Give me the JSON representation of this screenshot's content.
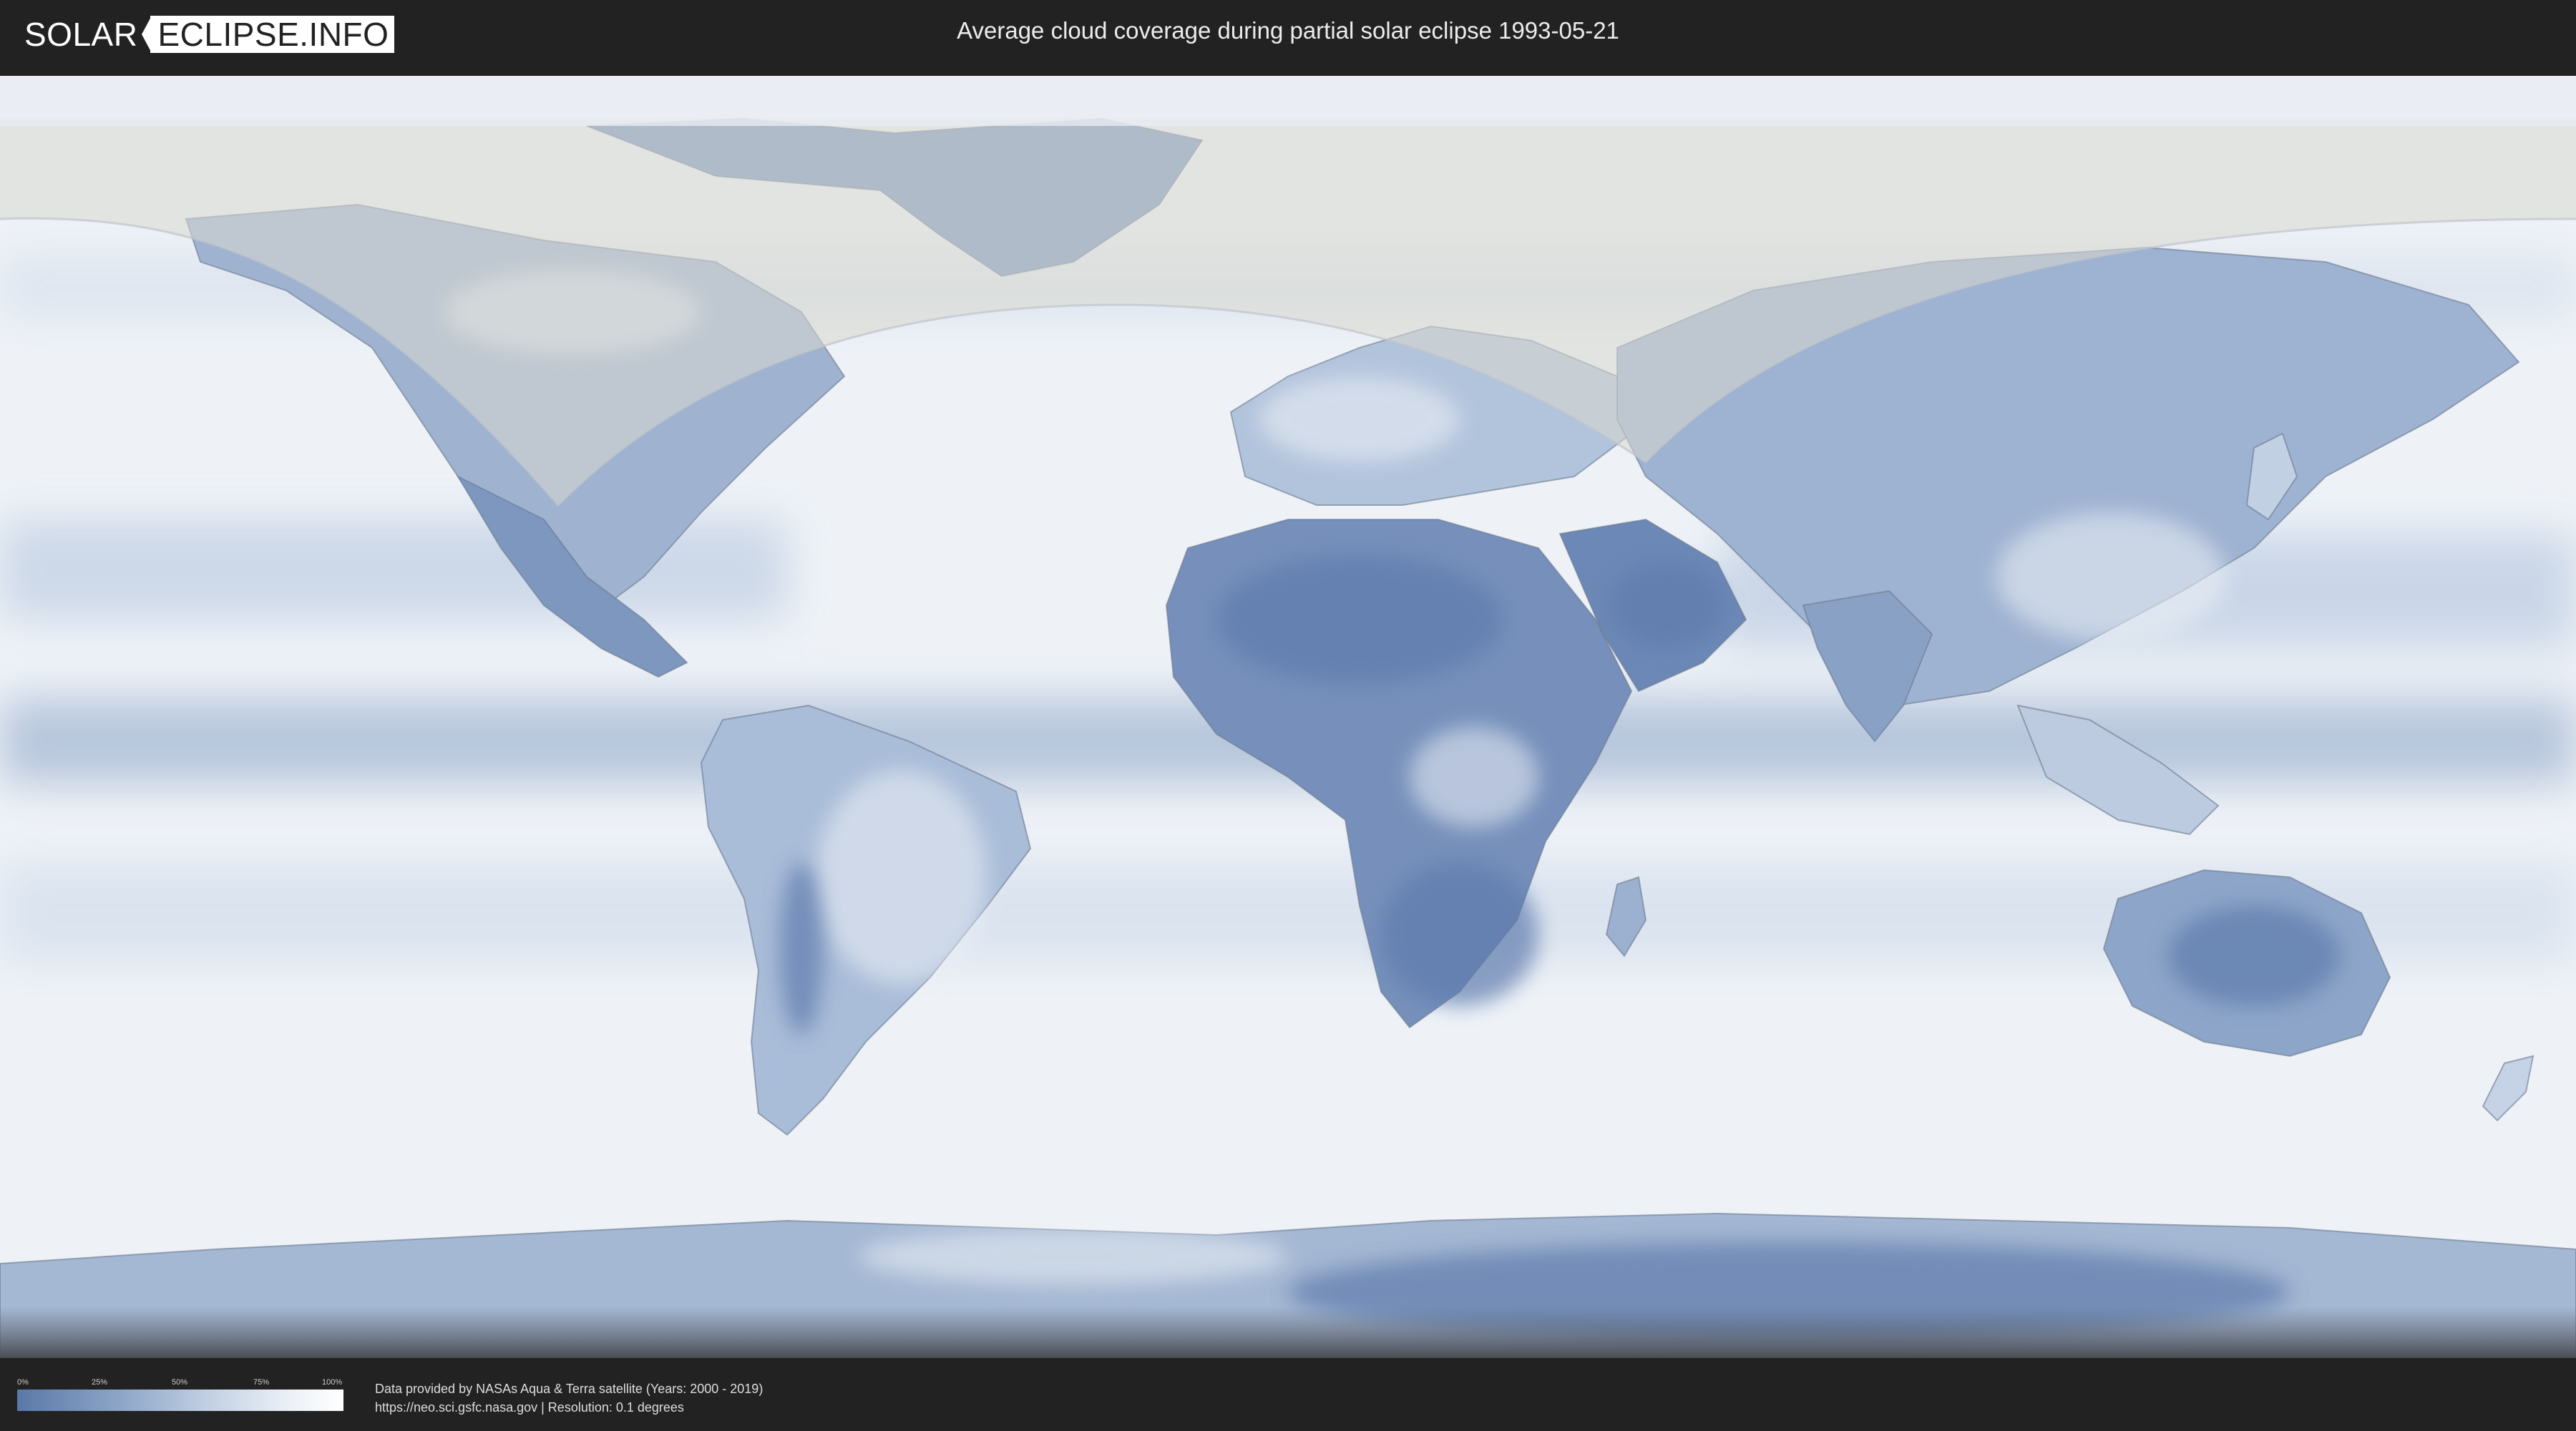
{
  "header": {
    "logo_left": "SOLAR",
    "logo_right": "ECLIPSE.INFO",
    "title": "Average cloud coverage during partial solar eclipse 1993-05-21"
  },
  "legend": {
    "ticks": [
      "0%",
      "25%",
      "50%",
      "75%",
      "100%"
    ],
    "colors": {
      "low": "#5a78a8",
      "high": "#ffffff"
    }
  },
  "credits": {
    "line1": "Data provided by NASAs Aqua & Terra satellite (Years: 2000 - 2019)",
    "line2": "https://neo.sci.gsfc.nasa.gov | Resolution: 0.1 degrees"
  },
  "map": {
    "projection": "equirectangular",
    "eclipse_visibility_shaded": true,
    "palette": {
      "ocean_cloud": "#eef2f7",
      "land_clear": "#6f8bb6",
      "coast": "#6b7a8f"
    }
  }
}
